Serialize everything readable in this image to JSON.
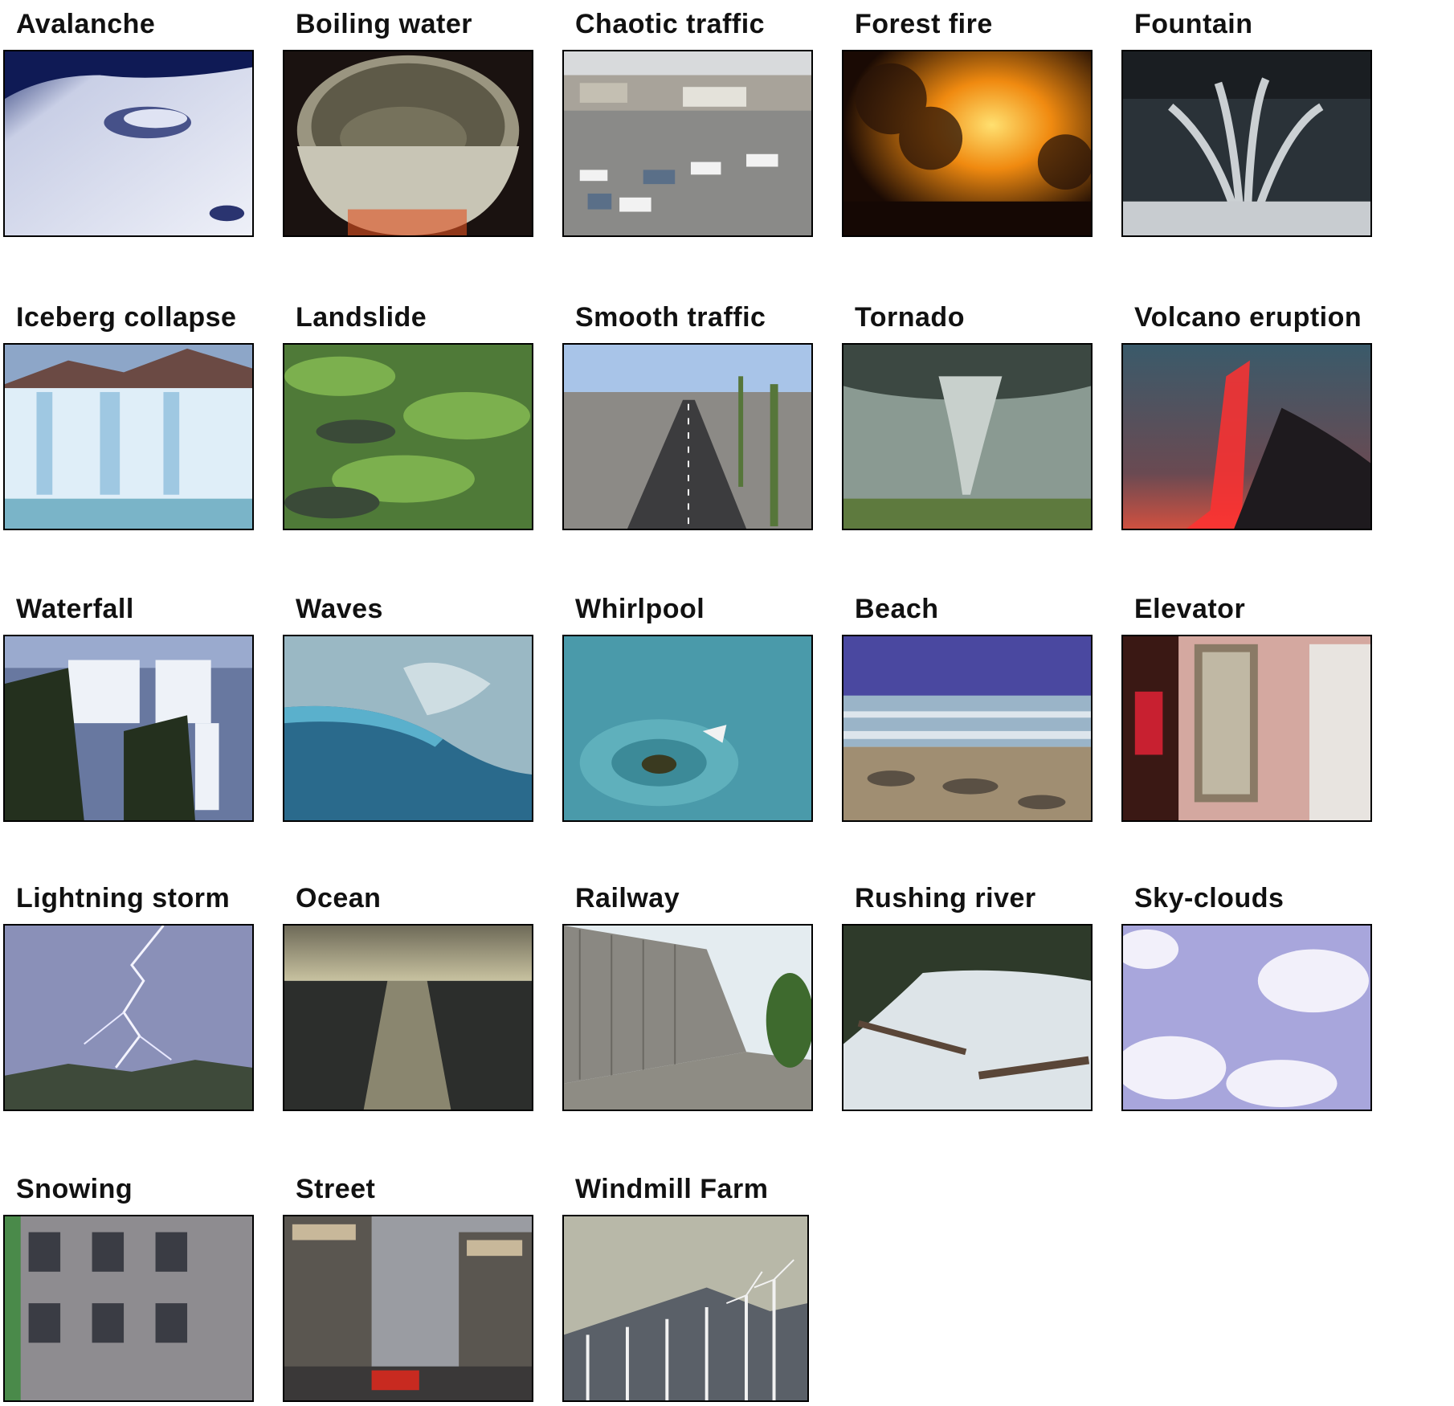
{
  "grid": {
    "tiles": [
      {
        "label": "Avalanche",
        "scene": "avalanche"
      },
      {
        "label": "Boiling water",
        "scene": "boiling"
      },
      {
        "label": "Chaotic traffic",
        "scene": "traffic"
      },
      {
        "label": "Forest fire",
        "scene": "fire"
      },
      {
        "label": "Fountain",
        "scene": "fountain"
      },
      {
        "label": "Iceberg collapse",
        "scene": "iceberg"
      },
      {
        "label": "Landslide",
        "scene": "landslide"
      },
      {
        "label": "Smooth traffic",
        "scene": "road"
      },
      {
        "label": "Tornado",
        "scene": "tornado"
      },
      {
        "label": "Volcano eruption",
        "scene": "volcano"
      },
      {
        "label": "Waterfall",
        "scene": "waterfall"
      },
      {
        "label": "Waves",
        "scene": "waves"
      },
      {
        "label": "Whirlpool",
        "scene": "whirlpool"
      },
      {
        "label": "Beach",
        "scene": "beach"
      },
      {
        "label": "Elevator",
        "scene": "elevator"
      },
      {
        "label": "Lightning storm",
        "scene": "lightning"
      },
      {
        "label": "Ocean",
        "scene": "ocean"
      },
      {
        "label": "Railway",
        "scene": "railway"
      },
      {
        "label": "Rushing river",
        "scene": "river"
      },
      {
        "label": "Sky-clouds",
        "scene": "clouds"
      },
      {
        "label": "Snowing",
        "scene": "snowing"
      },
      {
        "label": "Street",
        "scene": "street"
      },
      {
        "label": "Windmill Farm",
        "scene": "windmill"
      }
    ]
  }
}
